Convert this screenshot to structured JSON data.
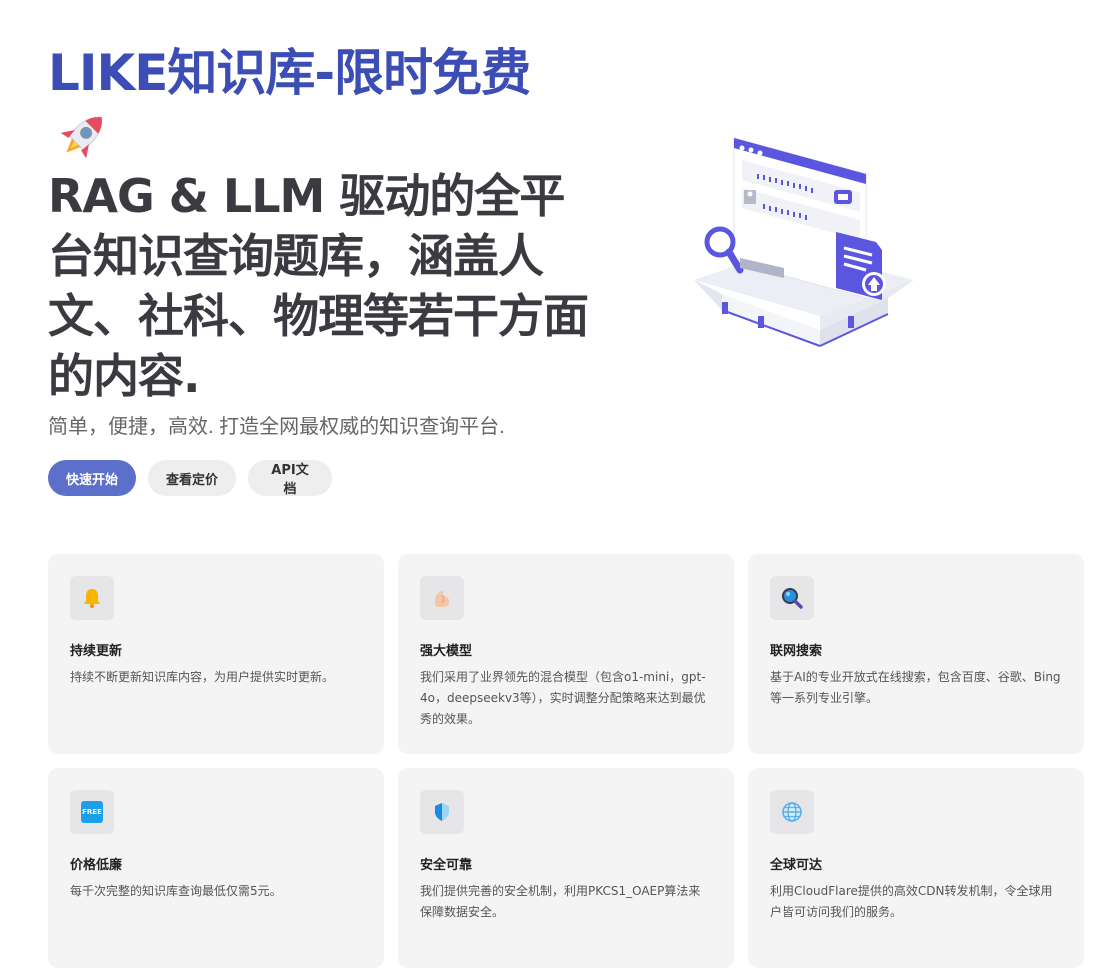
{
  "hero": {
    "brand": "LIKE知识库-限时免费",
    "headline": "RAG & LLM 驱动的全平台知识查询题库，涵盖人文、社科、物理等若干方面的内容.",
    "subtitle": "简单，便捷，高效. 打造全网最权威的知识查询平台."
  },
  "actions": {
    "quick_start": "快速开始",
    "pricing": "查看定价",
    "api_docs": "API文档"
  },
  "features": [
    {
      "icon": "bell-icon",
      "title": "持续更新",
      "desc": "持续不断更新知识库内容，为用户提供实时更新。"
    },
    {
      "icon": "flexed-biceps-icon",
      "title": "强大模型",
      "desc": "我们采用了业界领先的混合模型（包含o1-mini，gpt-4o，deepseekv3等），实时调整分配策略来达到最优秀的效果。"
    },
    {
      "icon": "magnifier-icon",
      "title": "联网搜索",
      "desc": "基于AI的专业开放式在线搜索，包含百度、谷歌、Bing等一系列专业引擎。"
    },
    {
      "icon": "free-icon",
      "title": "价格低廉",
      "desc": "每千次完整的知识库查询最低仅需5元。",
      "badge": "FREE"
    },
    {
      "icon": "shield-icon",
      "title": "安全可靠",
      "desc": "我们提供完善的安全机制，利用PKCS1_OAEP算法来保障数据安全。"
    },
    {
      "icon": "globe-icon",
      "title": "全球可达",
      "desc": "利用CloudFlare提供的高效CDN转发机制，令全球用户皆可访问我们的服务。"
    }
  ],
  "colors": {
    "brand": "#3c4db6",
    "primary_button": "#5b6fcb",
    "illustration_accent": "#5a56e0"
  }
}
